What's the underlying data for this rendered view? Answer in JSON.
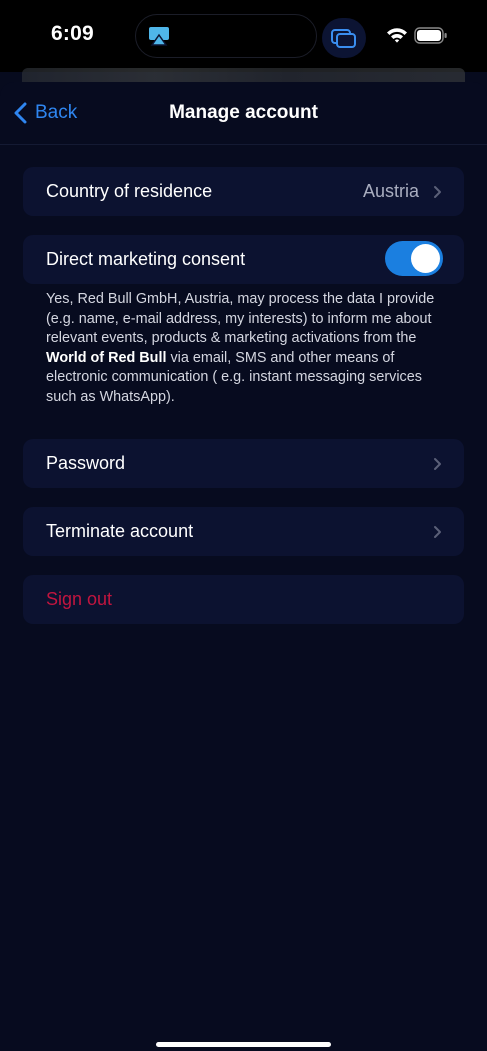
{
  "status_bar": {
    "time": "6:09",
    "icons": [
      "airplay-icon",
      "screen-mirroring-icon",
      "wifi-icon",
      "battery-icon"
    ]
  },
  "nav": {
    "back_label": "Back",
    "title": "Manage account"
  },
  "rows": {
    "country": {
      "label": "Country of residence",
      "value": "Austria"
    },
    "marketing": {
      "label": "Direct marketing consent",
      "toggle_on": true
    },
    "password": {
      "label": "Password"
    },
    "terminate": {
      "label": "Terminate account"
    },
    "signout": {
      "label": "Sign out"
    }
  },
  "consent": {
    "text_before": "Yes, Red Bull GmbH, Austria, may process the  data I provide (e.g. name, e-mail address, my interests) to inform me about relevant events, products & marketing activations from the ",
    "brand": "World of Red Bull",
    "text_after": " via email, SMS and other means of electronic communication ( e.g. instant messaging services such as WhatsApp)."
  },
  "colors": {
    "accent": "#2f86f0",
    "toggle_on": "#1b7fe0",
    "danger": "#c2153f",
    "background": "#070b1f",
    "row_background": "#0c1230"
  }
}
